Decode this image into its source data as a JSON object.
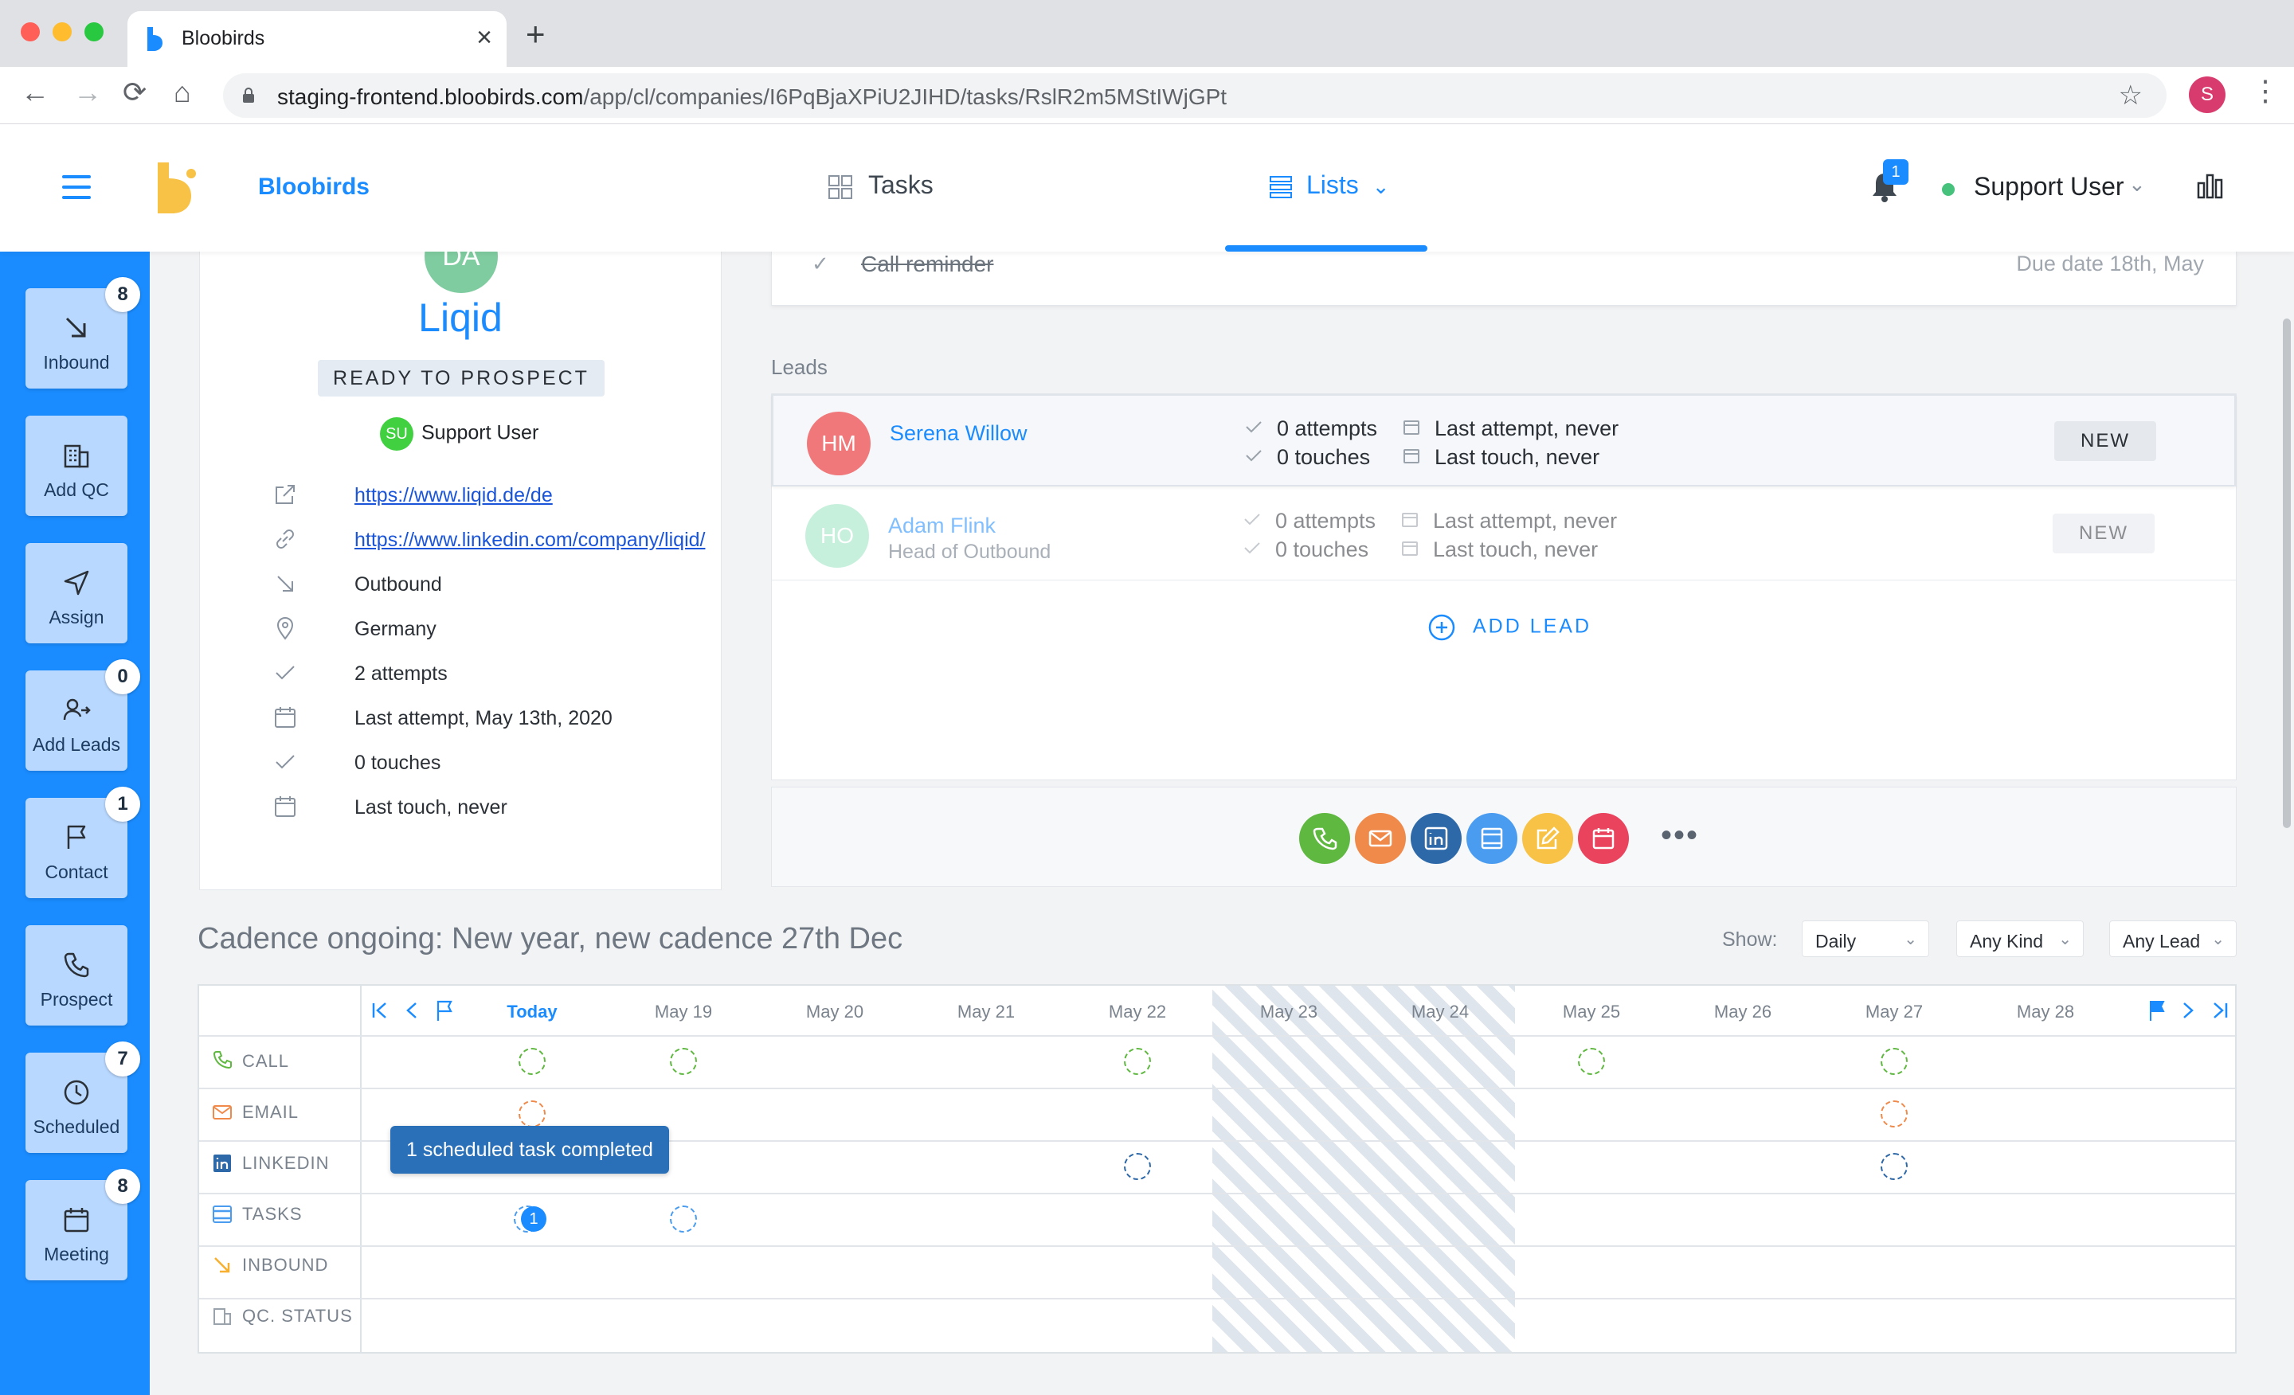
{
  "browser": {
    "tab_title": "Bloobirds",
    "new_tab": "+",
    "close": "×",
    "url_host": "staging-frontend.bloobirds.com",
    "url_path": "/app/cl/companies/I6PqBjaXPiU2JIHD/tasks/RslR2m5MStIWjGPt",
    "profile_initial": "S",
    "back": "←",
    "forward": "→",
    "reload": "⟳",
    "home": "⌂",
    "star": "☆",
    "menu": "⋮"
  },
  "header": {
    "brand": "Bloobirds",
    "tasks_label": "Tasks",
    "lists_label": "Lists",
    "lists_chevron": "⌄",
    "notification_count": "1",
    "user_name": "Support User",
    "user_chevron": "⌄"
  },
  "sidebar": {
    "items": [
      {
        "label": "Inbound",
        "badge": "8",
        "icon": "arrow-down-right-icon"
      },
      {
        "label": "Add QC",
        "badge": "",
        "icon": "building-icon"
      },
      {
        "label": "Assign",
        "badge": "",
        "icon": "send-icon"
      },
      {
        "label": "Add Leads",
        "badge": "0",
        "icon": "add-user-icon"
      },
      {
        "label": "Contact",
        "badge": "1",
        "icon": "flag-icon"
      },
      {
        "label": "Prospect",
        "badge": "",
        "icon": "phone-icon"
      },
      {
        "label": "Scheduled",
        "badge": "7",
        "icon": "clock-icon"
      },
      {
        "label": "Meeting",
        "badge": "8",
        "icon": "calendar-icon"
      }
    ]
  },
  "company": {
    "avatar_initials": "DA",
    "name": "Liqid",
    "status": "READY TO PROSPECT",
    "owner_initials": "SU",
    "owner_name": "Support User",
    "website": "https://www.liqid.de/de",
    "linkedin": "https://www.linkedin.com/company/liqid/",
    "source": "Outbound",
    "country": "Germany",
    "attempts": "2 attempts",
    "last_attempt": "Last attempt, May 13th, 2020",
    "touches": "0 touches",
    "last_touch": "Last touch, never"
  },
  "top_task": {
    "check": "✓",
    "name": "Call reminder",
    "due": "Due date 18th, May"
  },
  "leads": {
    "title": "Leads",
    "items": [
      {
        "initials": "HM",
        "name": "Serena Willow",
        "role": "",
        "attempts": "0 attempts",
        "touches": "0 touches",
        "last_attempt": "Last attempt, never",
        "last_touch": "Last touch, never",
        "status": "NEW",
        "color": "#f0787a"
      },
      {
        "initials": "HO",
        "name": "Adam Flink",
        "role": "Head of Outbound",
        "attempts": "0 attempts",
        "touches": "0 touches",
        "last_attempt": "Last attempt, never",
        "last_touch": "Last touch, never",
        "status": "NEW",
        "color": "#8ee0b8"
      }
    ],
    "add_label": "ADD LEAD"
  },
  "actions": {
    "colors": {
      "call": "#5fb83f",
      "email": "#f08a4b",
      "linkedin": "#2d68a8",
      "task": "#4a9cf0",
      "note": "#f7c245",
      "meeting": "#e9435e"
    },
    "more": "•••"
  },
  "cadence": {
    "title": "Cadence ongoing: New year, new cadence 27th Dec",
    "show_label": "Show:",
    "filters": {
      "period": "Daily",
      "kind": "Any Kind",
      "lead": "Any Lead"
    },
    "chevron": "⌄",
    "days": [
      "Today",
      "May 19",
      "May 20",
      "May 21",
      "May 22",
      "May 23",
      "May 24",
      "May 25",
      "May 26",
      "May 27",
      "May 28"
    ],
    "types": [
      {
        "label": "CALL",
        "color": "#5fb83f"
      },
      {
        "label": "EMAIL",
        "color": "#f08a4b"
      },
      {
        "label": "LINKEDIN",
        "color": "#2d68a8"
      },
      {
        "label": "TASKS",
        "color": "#4a9cf0"
      },
      {
        "label": "INBOUND",
        "color": "#f7b030"
      },
      {
        "label": "QC. STATUS",
        "color": "#9aa2ab"
      }
    ],
    "tooltip": "1 scheduled task completed",
    "task_count": "1"
  }
}
